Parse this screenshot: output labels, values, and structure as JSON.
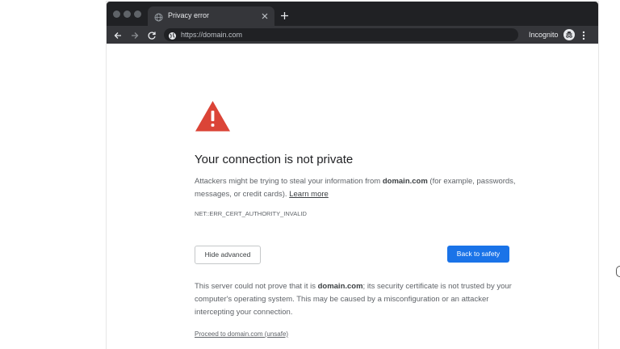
{
  "browser": {
    "tab": {
      "title": "Privacy error"
    },
    "address_bar": {
      "url": "https://domain.com"
    },
    "incognito_label": "Incognito"
  },
  "page": {
    "heading": "Your connection is not private",
    "intro_before": "Attackers might be trying to steal your information from ",
    "intro_domain": "domain.com",
    "intro_after": " (for example, passwords, messages, or credit cards). ",
    "learn_more": "Learn more",
    "error_code": "NET::ERR_CERT_AUTHORITY_INVALID",
    "hide_advanced": "Hide advanced",
    "back_to_safety": "Back to safety",
    "details_before": "This server could not prove that it is ",
    "details_domain": "domain.com",
    "details_after": "; its security certificate is not trusted by your computer's operating system. This may be caused by a misconfiguration or an attacker intercepting your connection.",
    "proceed_link": "Proceed to domain.com (unsafe)"
  },
  "colors": {
    "titlebar": "#202124",
    "toolbar": "#35363a",
    "warning_red": "#db4437",
    "primary_button": "#1a73e8"
  }
}
